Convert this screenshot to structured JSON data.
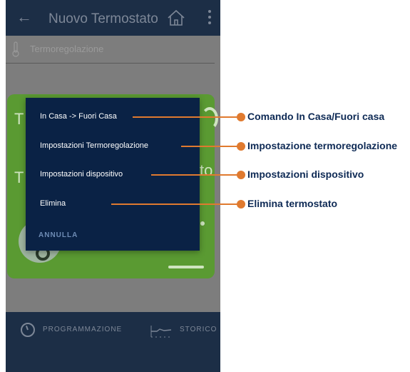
{
  "appbar": {
    "title": "Nuovo Termostato",
    "back_icon": "arrow-left-icon",
    "home_icon": "home-icon",
    "more_icon": "more-vert-icon"
  },
  "subheader": {
    "label": "Termoregolazione",
    "icon": "thermometer-icon"
  },
  "card": {
    "partial_text_1": "T",
    "partial_text_2": "T",
    "partial_text_3": "to"
  },
  "dialog": {
    "items": [
      {
        "label": "In Casa -> Fuori Casa"
      },
      {
        "label": "Impostazioni Termoregolazione"
      },
      {
        "label": "Impostazioni dispositivo"
      },
      {
        "label": "Elimina"
      }
    ],
    "cancel_label": "ANNULLA"
  },
  "bottom_bar": {
    "programmazione_label": "PROGRAMMAZIONE",
    "storico_label": "STORICO"
  },
  "callouts": [
    {
      "label": "Comando In Casa/Fuori casa"
    },
    {
      "label": "Impostazione termoregolazione"
    },
    {
      "label": "Impostazioni dispositivo"
    },
    {
      "label": "Elimina termostato"
    }
  ],
  "colors": {
    "appbar": "#1c2e46",
    "dialog": "#0a2245",
    "card": "#5a9a32",
    "callout_line": "#e07a2f",
    "callout_text": "#0e2a55"
  }
}
